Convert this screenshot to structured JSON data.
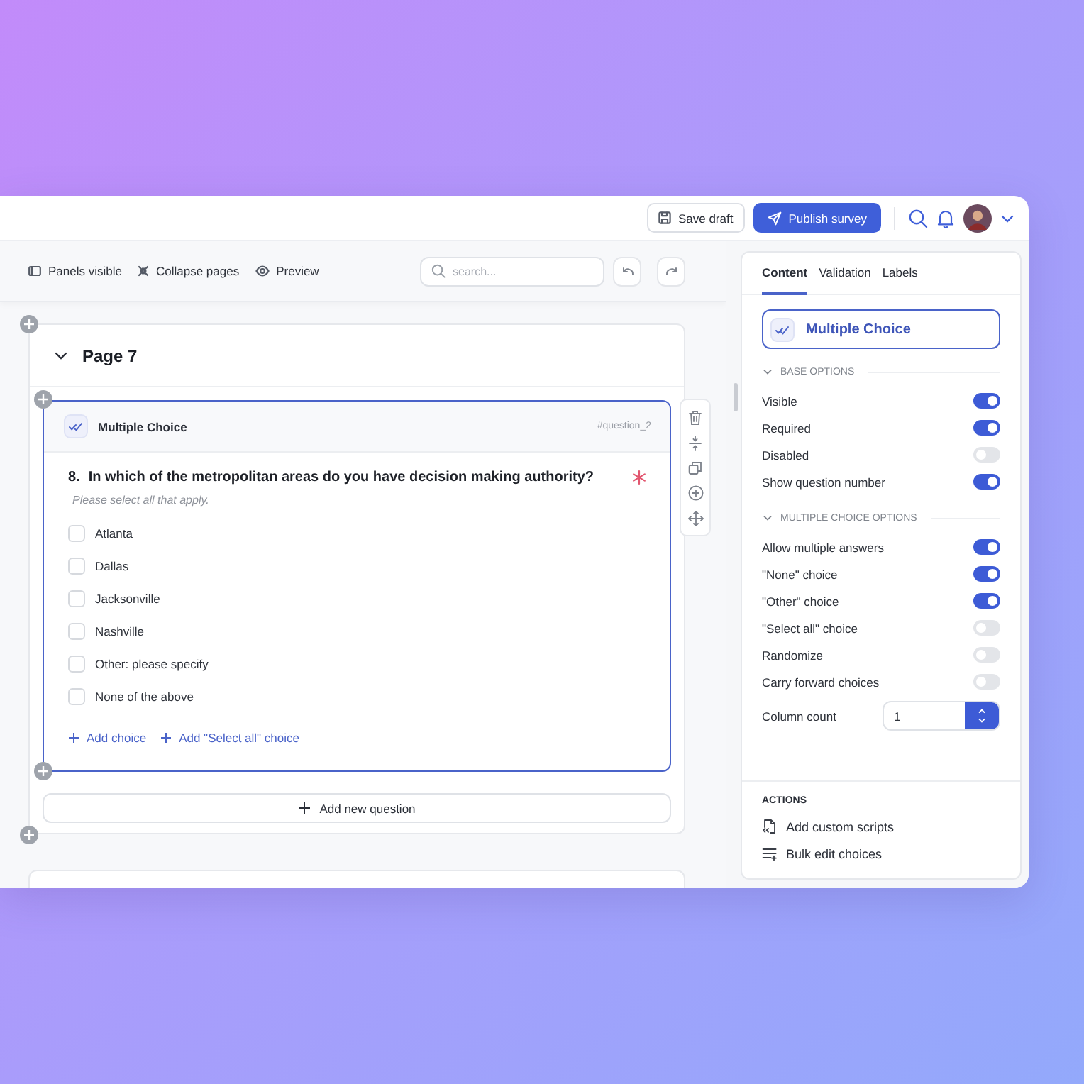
{
  "top_bar": {
    "save_draft": "Save draft",
    "publish": "Publish survey"
  },
  "editor_toolbar": {
    "items": [
      {
        "kind": "panels",
        "label": "Panels visible"
      },
      {
        "kind": "collapse",
        "label": "Collapse pages"
      },
      {
        "kind": "preview",
        "label": "Preview"
      }
    ],
    "search": {
      "placeholder": "search..."
    }
  },
  "page": {
    "title": "Page 7",
    "expanded": true,
    "question": {
      "type": "Multiple Choice",
      "id": "#question_2",
      "number": "8.",
      "text": "In which of the metropolitan areas do you have decision making authority?",
      "required": true,
      "hint": "Please select all that apply.",
      "choices": [
        {
          "label": "Atlanta",
          "checked": false
        },
        {
          "label": "Dallas",
          "checked": false
        },
        {
          "label": "Jacksonville",
          "checked": false
        },
        {
          "label": "Nashville",
          "checked": false
        },
        {
          "label": "Other: please specify",
          "checked": false
        },
        {
          "label": "None of the above",
          "checked": false
        }
      ],
      "add_links": [
        "Add choice",
        "Add \"Select all\" choice"
      ]
    },
    "add_question": "Add new question"
  },
  "panel": {
    "tabs": [
      {
        "label": "Content",
        "selected": true
      },
      {
        "label": "Validation",
        "selected": false
      },
      {
        "label": "Labels",
        "selected": false
      }
    ],
    "question_type": "Multiple Choice",
    "sections": [
      {
        "title": "BASE OPTIONS",
        "expanded": true,
        "options": [
          {
            "label": "Visible",
            "on": true
          },
          {
            "label": "Required",
            "on": true
          },
          {
            "label": "Disabled",
            "on": false
          },
          {
            "label": "Show question number",
            "on": true
          }
        ]
      },
      {
        "title": "MULTIPLE CHOICE OPTIONS",
        "expanded": true,
        "options": [
          {
            "label": "Allow multiple answers",
            "on": true
          },
          {
            "label": "\"None\" choice",
            "on": true
          },
          {
            "label": "\"Other\" choice",
            "on": true
          },
          {
            "label": "\"Select all\" choice",
            "on": false
          },
          {
            "label": "Randomize",
            "on": false
          },
          {
            "label": "Carry forward choices",
            "on": false
          }
        ]
      }
    ],
    "column_count": {
      "label": "Column count",
      "value": "1"
    },
    "actions": {
      "title": "ACTIONS",
      "items": [
        {
          "kind": "script",
          "label": "Add custom scripts"
        },
        {
          "kind": "bulk",
          "label": "Bulk edit choices"
        }
      ]
    }
  }
}
